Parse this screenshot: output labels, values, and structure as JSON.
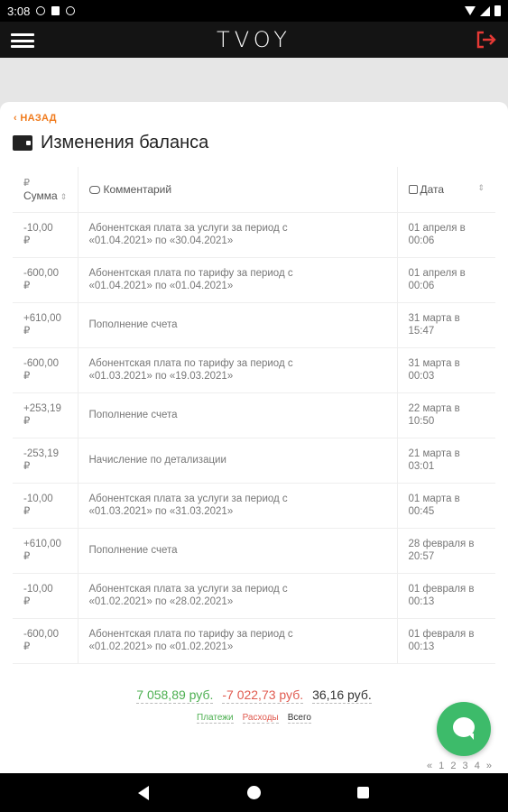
{
  "status": {
    "time": "3:08"
  },
  "app": {
    "logo": "TVOY"
  },
  "page": {
    "back_label": "НАЗАД",
    "title": "Изменения баланса"
  },
  "table": {
    "headers": {
      "currency": "₽",
      "amount": "Сумма",
      "comment": "Комментарий",
      "date": "Дата"
    },
    "rows": [
      {
        "amount": "-10,00",
        "currency": "₽",
        "sign": "neg",
        "comment_line1": "Абонентская плата за услуги за период с",
        "comment_line2": "«01.04.2021» по «30.04.2021»",
        "date_line1": "01 апреля в",
        "date_line2": "00:06"
      },
      {
        "amount": "-600,00",
        "currency": "₽",
        "sign": "neg",
        "comment_line1": "Абонентская плата по тарифу за период с",
        "comment_line2": "«01.04.2021» по «01.04.2021»",
        "date_line1": "01 апреля в",
        "date_line2": "00:06"
      },
      {
        "amount": "+610,00",
        "currency": "₽",
        "sign": "pos",
        "comment_line1": "Пополнение счета",
        "comment_line2": "",
        "date_line1": "31 марта в",
        "date_line2": "15:47"
      },
      {
        "amount": "-600,00",
        "currency": "₽",
        "sign": "neg",
        "comment_line1": "Абонентская плата по тарифу за период с",
        "comment_line2": "«01.03.2021» по «19.03.2021»",
        "date_line1": "31 марта в",
        "date_line2": "00:03"
      },
      {
        "amount": "+253,19",
        "currency": "₽",
        "sign": "pos",
        "comment_line1": "Пополнение счета",
        "comment_line2": "",
        "date_line1": "22 марта в",
        "date_line2": "10:50"
      },
      {
        "amount": "-253,19",
        "currency": "₽",
        "sign": "neg",
        "comment_line1": "Начисление по детализации",
        "comment_line2": "",
        "date_line1": "21 марта в",
        "date_line2": "03:01"
      },
      {
        "amount": "-10,00",
        "currency": "₽",
        "sign": "neg",
        "comment_line1": "Абонентская плата за услуги за период с",
        "comment_line2": "«01.03.2021» по «31.03.2021»",
        "date_line1": "01 марта в",
        "date_line2": "00:45"
      },
      {
        "amount": "+610,00",
        "currency": "₽",
        "sign": "pos",
        "comment_line1": "Пополнение счета",
        "comment_line2": "",
        "date_line1": "28 февраля в",
        "date_line2": "20:57"
      },
      {
        "amount": "-10,00",
        "currency": "₽",
        "sign": "neg",
        "comment_line1": "Абонентская плата за услуги за период с",
        "comment_line2": "«01.02.2021» по «28.02.2021»",
        "date_line1": "01 февраля в",
        "date_line2": "00:13"
      },
      {
        "amount": "-600,00",
        "currency": "₽",
        "sign": "neg",
        "comment_line1": "Абонентская плата по тарифу за период с",
        "comment_line2": "«01.02.2021» по «01.02.2021»",
        "date_line1": "01 февраля в",
        "date_line2": "00:13"
      }
    ]
  },
  "totals": {
    "payments": "7 058,89 руб.",
    "expenses": "-7 022,73 руб.",
    "total": "36,16 руб.",
    "payments_label": "Платежи",
    "expenses_label": "Расходы",
    "total_label": "Всего"
  },
  "pagination": {
    "prev": "«",
    "pages": [
      "1",
      "2",
      "3",
      "4"
    ],
    "next": "»"
  },
  "colors": {
    "accent": "#f07b1d",
    "positive": "#4caf50",
    "negative": "#e05a4f",
    "logout": "#e53935",
    "fab": "#3dbb6a"
  }
}
